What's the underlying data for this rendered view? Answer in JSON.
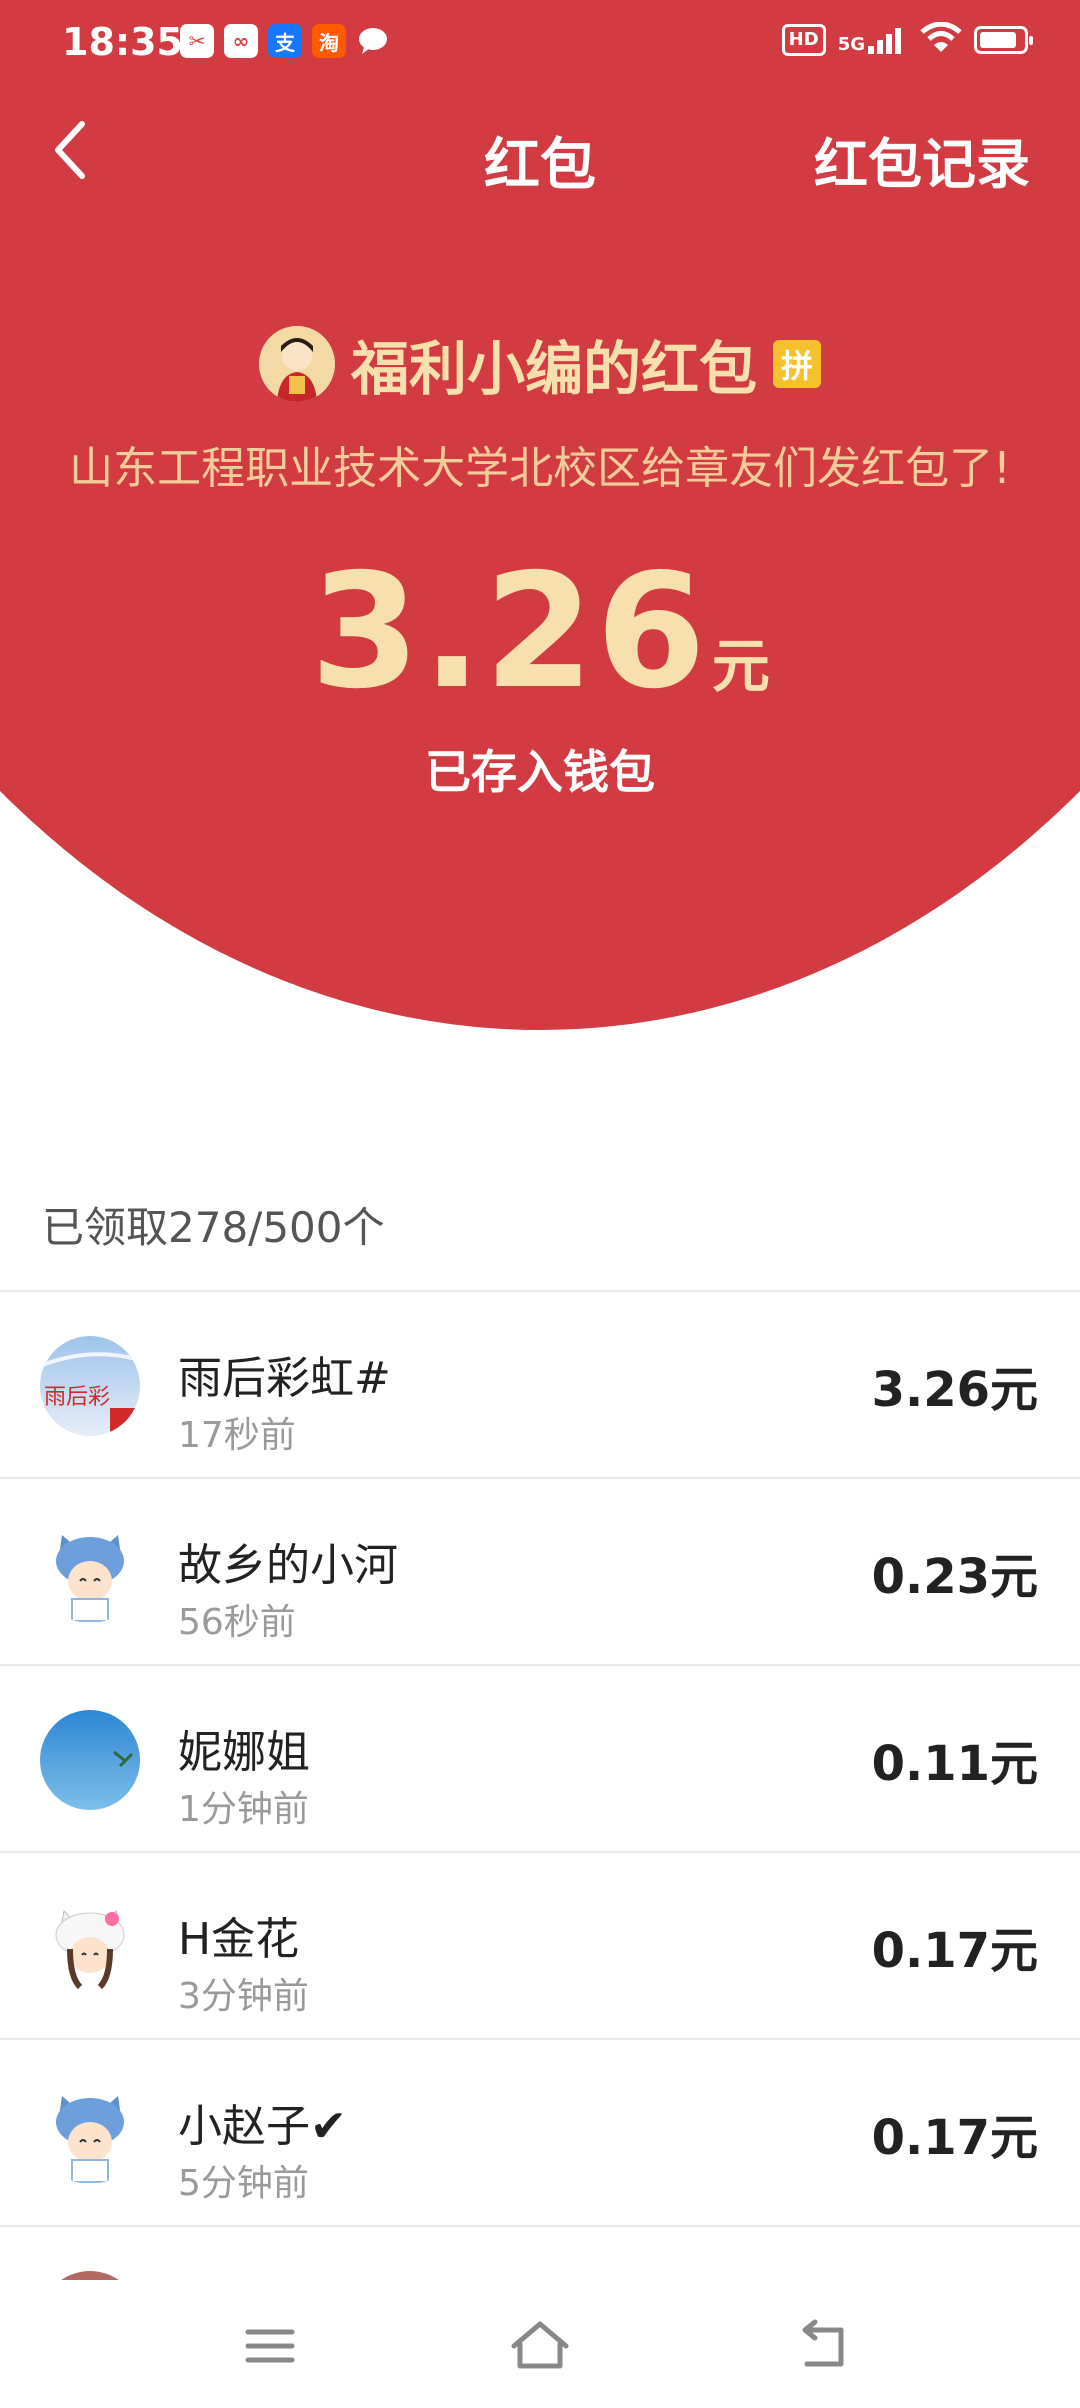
{
  "status_bar": {
    "time": "18:35",
    "apps": [
      {
        "icon": "app-scissors-icon",
        "glyph": "✂",
        "color": "#e0434a"
      },
      {
        "icon": "app-link-icon",
        "glyph": "∞",
        "color": "#e0434a"
      },
      {
        "icon": "alipay-icon",
        "glyph": "支",
        "color": "#1677ff"
      },
      {
        "icon": "taobao-icon",
        "glyph": "淘",
        "color": "#ff5a00"
      },
      {
        "icon": "message-icon",
        "glyph": "●",
        "color": "#e0434a"
      }
    ],
    "hd": "HD",
    "network": "5G",
    "battery_level": 0.85
  },
  "nav": {
    "back_icon": "chevron-left-icon",
    "title": "红包",
    "record_label": "红包记录"
  },
  "packet": {
    "sender": "福利小编的红包",
    "pin_badge": "拼",
    "greeting": "山东工程职业技术大学北校区给章友们发红包了!",
    "amount": "3.26",
    "unit": "元",
    "saved_note": "已存入钱包"
  },
  "claimed": {
    "label": "已领取278/500个"
  },
  "receivers": [
    {
      "name": "雨后彩虹#",
      "time": "17秒前",
      "amount": "3.26元",
      "avatar": "sky-avatar"
    },
    {
      "name": "故乡的小河",
      "time": "56秒前",
      "amount": "0.23元",
      "avatar": "cat-hat-avatar"
    },
    {
      "name": "妮娜姐",
      "time": "1分钟前",
      "amount": "0.11元",
      "avatar": "blue-sky-avatar"
    },
    {
      "name": "H金花",
      "time": "3分钟前",
      "amount": "0.17元",
      "avatar": "kitty-hat-avatar"
    },
    {
      "name": "小赵子✔",
      "time": "5分钟前",
      "amount": "0.17元",
      "avatar": "cat-hat-avatar"
    }
  ],
  "colors": {
    "header_red": "#d13b41",
    "gold_text": "#f7dfae"
  },
  "bottom_nav": {
    "menu_icon": "menu-icon",
    "home_icon": "home-icon",
    "back_icon": "back-icon"
  }
}
